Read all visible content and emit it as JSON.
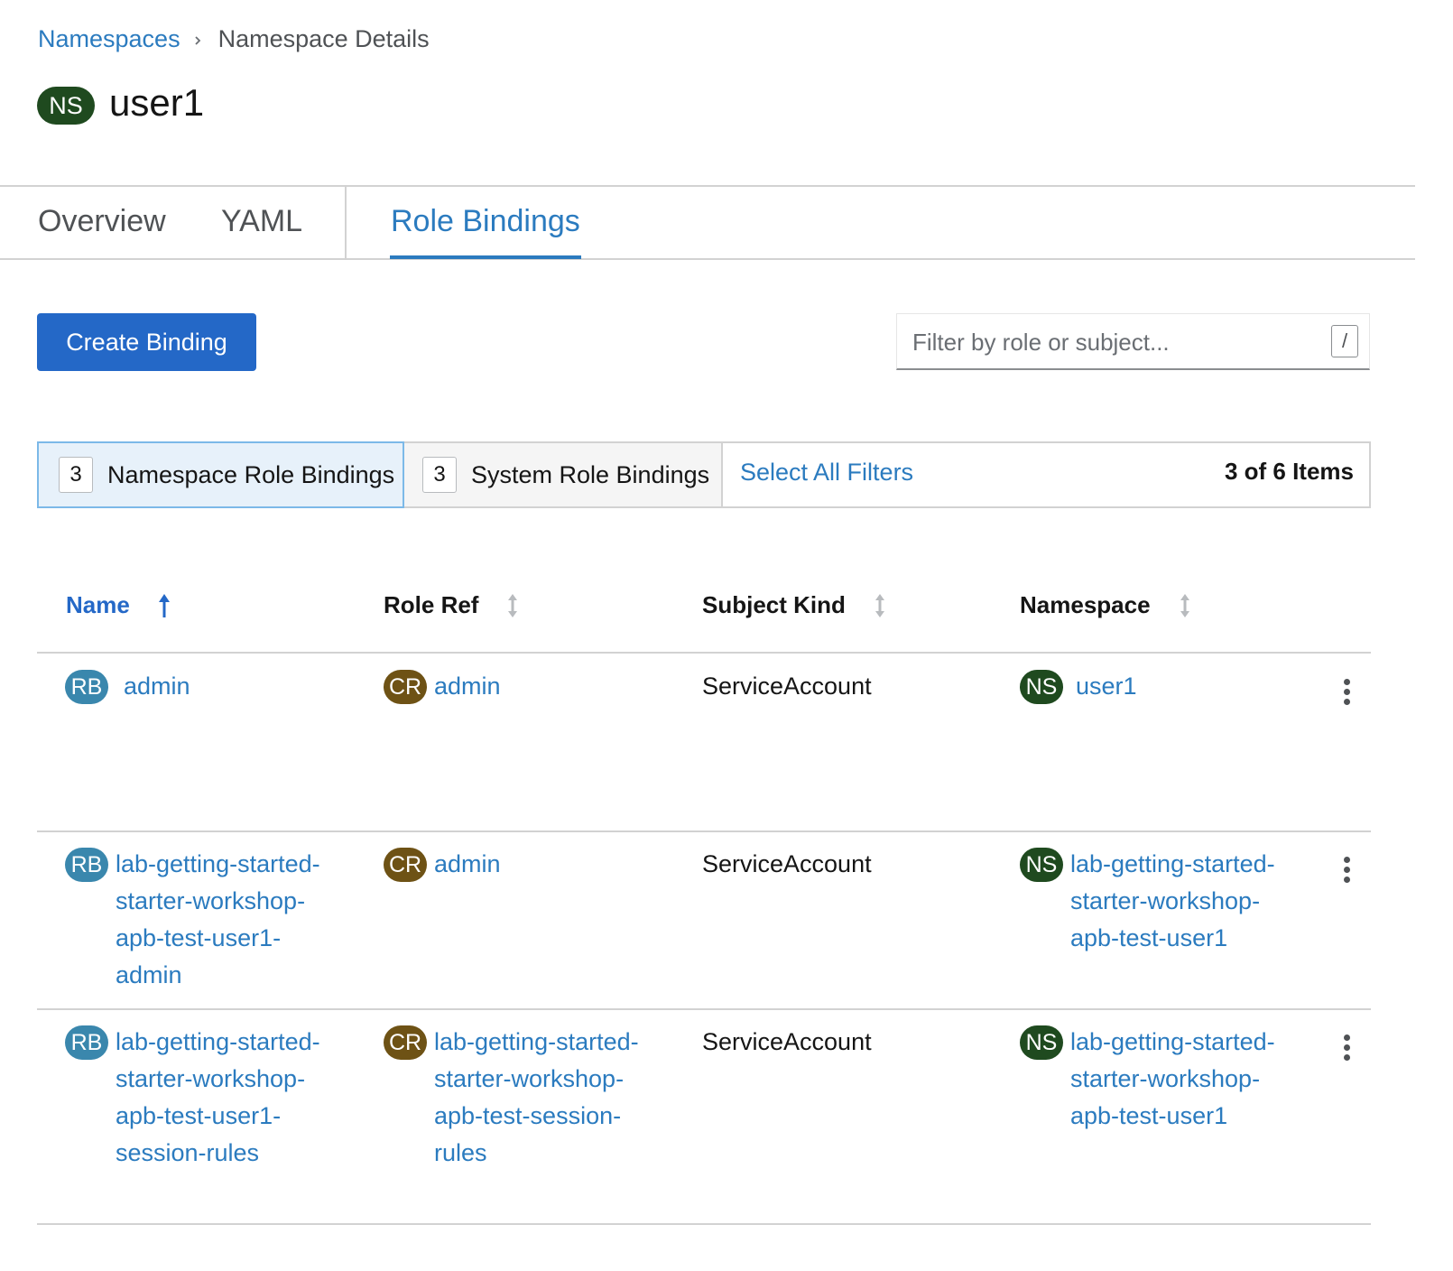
{
  "breadcrumb": {
    "parent": "Namespaces",
    "current": "Namespace Details"
  },
  "page": {
    "badge": "NS",
    "title": "user1"
  },
  "tabs": [
    "Overview",
    "YAML",
    "Role Bindings"
  ],
  "active_tab": "Role Bindings",
  "toolbar": {
    "create_label": "Create Binding",
    "filter_placeholder": "Filter by role or subject...",
    "filter_shortcut": "/"
  },
  "filters": {
    "namespace": {
      "count": "3",
      "label": "Namespace Role Bindings",
      "selected": true
    },
    "system": {
      "count": "3",
      "label": "System Role Bindings",
      "selected": false
    },
    "select_all": "Select All Filters",
    "items_count": "3 of 6 Items"
  },
  "table": {
    "columns": [
      "Name",
      "Role Ref",
      "Subject Kind",
      "Namespace"
    ],
    "sorted_by": "Name",
    "rows": [
      {
        "name_badge": "RB",
        "name": "admin",
        "role_badge": "CR",
        "role": "admin",
        "subject_kind": "ServiceAccount",
        "ns_badge": "NS",
        "namespace": "user1"
      },
      {
        "name_badge": "RB",
        "name": "lab-getting-started-starter-workshop-apb-test-user1-admin",
        "role_badge": "CR",
        "role": "admin",
        "subject_kind": "ServiceAccount",
        "ns_badge": "NS",
        "namespace": "lab-getting-started-starter-workshop-apb-test-user1"
      },
      {
        "name_badge": "RB",
        "name": "lab-getting-started-starter-workshop-apb-test-user1-session-rules",
        "role_badge": "CR",
        "role": "lab-getting-started-starter-workshop-apb-test-session-rules",
        "subject_kind": "ServiceAccount",
        "ns_badge": "NS",
        "namespace": "lab-getting-started-starter-workshop-apb-test-user1"
      }
    ]
  },
  "icons": {
    "breadcrumb_separator": "chevron-right-icon",
    "sort_asc": "arrow-up-icon",
    "sort": "sort-icon",
    "row_actions": "kebab-icon"
  },
  "colors": {
    "link": "#2b7bbf",
    "primary": "#2468c7",
    "ns_badge": "#1f4a1f",
    "rb_badge": "#3a87ad",
    "cr_badge": "#6e5215"
  }
}
